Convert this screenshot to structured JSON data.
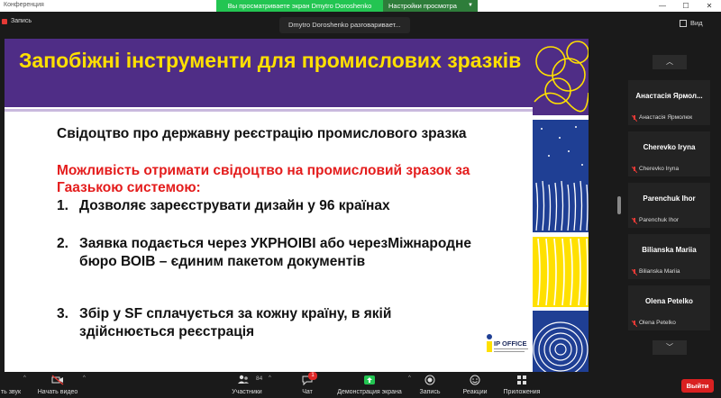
{
  "window": {
    "title": "Конференция",
    "share_banner": "Вы просматриваете экран Dmytro Doroshenko",
    "view_options": "Настройки просмотра"
  },
  "top": {
    "recording": "Запись",
    "speaking": "Dmytro Doroshenko разговаривает...",
    "view": "Вид"
  },
  "slide": {
    "title": "Запобіжні інструменти для промислових зразків",
    "subtitle": "Свідоцтво про державну реєстрацію промислового зразка",
    "highlight": "Можливість отримати свідоцтво на промисловий зразок за Гаазькою системою:",
    "items": [
      {
        "num": "1.",
        "text": "Дозволяє зареєструвати дизайн у 96 країнах"
      },
      {
        "num": "2.",
        "text": "Заявка подається через УКРНОІВІ або черезМіжнародне бюро ВОІВ – єдиним пакетом документів"
      },
      {
        "num": "3.",
        "text": "Збір у SF сплачується за кожну країну, в якій здійснюється реєстрація"
      }
    ],
    "logo_text": "IP OFFICE",
    "colors": {
      "header": "#4f2d86",
      "title": "#ffe000",
      "highlight": "#e41d1d"
    }
  },
  "participants": [
    {
      "name": "Анастасія Ярмол...",
      "sub": "Анастасія Ярмолюк",
      "muted": true
    },
    {
      "name": "Cherevko Iryna",
      "sub": "Cherevko Iryna",
      "muted": true
    },
    {
      "name": "Parenchuk Ihor",
      "sub": "Parenchuk Ihor",
      "muted": true
    },
    {
      "name": "Bilianska Mariia",
      "sub": "Bilianska Mariia",
      "muted": true
    },
    {
      "name": "Olena Petelko",
      "sub": "Olena Petelko",
      "muted": true
    }
  ],
  "toolbar": {
    "audio": "ть звук",
    "video": "Начать видео",
    "participants": "Участники",
    "participants_count": "84",
    "chat": "Чат",
    "chat_badge": "1",
    "share": "Демонстрация экрана",
    "record": "Запись",
    "reactions": "Реакции",
    "apps": "Приложения",
    "exit": "Выйти"
  }
}
